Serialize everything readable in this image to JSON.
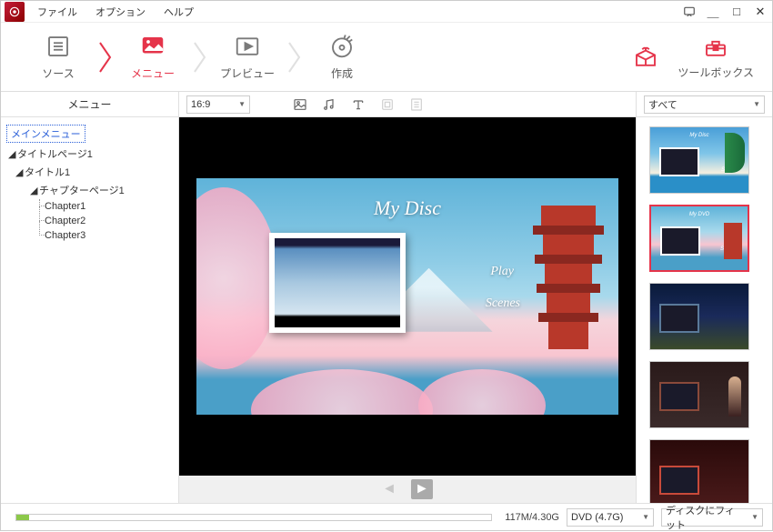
{
  "menubar": {
    "file": "ファイル",
    "option": "オプション",
    "help": "ヘルプ"
  },
  "toolbar": {
    "source": "ソース",
    "menu": "メニュー",
    "preview": "プレビュー",
    "create": "作成",
    "toolbox": "ツールボックス"
  },
  "subtoolbar": {
    "left_label": "メニュー",
    "aspect": "16:9",
    "filter": "すべて"
  },
  "tree": {
    "header": "メインメニュー",
    "title_page": "タイトルページ1",
    "title": "タイトル1",
    "chapter_page": "チャプターページ1",
    "chapters": [
      "Chapter1",
      "Chapter2",
      "Chapter3"
    ]
  },
  "preview": {
    "title": "My Disc",
    "play": "Play",
    "scenes": "Scenes"
  },
  "templates": {
    "items": [
      {
        "title": "My Disc"
      },
      {
        "title": "My DVD"
      },
      {
        "title": ""
      },
      {
        "title": ""
      },
      {
        "title": ""
      }
    ]
  },
  "statusbar": {
    "usage": "117M/4.30G",
    "disc_type": "DVD (4.7G)",
    "fit_mode": "ディスクにフィット"
  }
}
